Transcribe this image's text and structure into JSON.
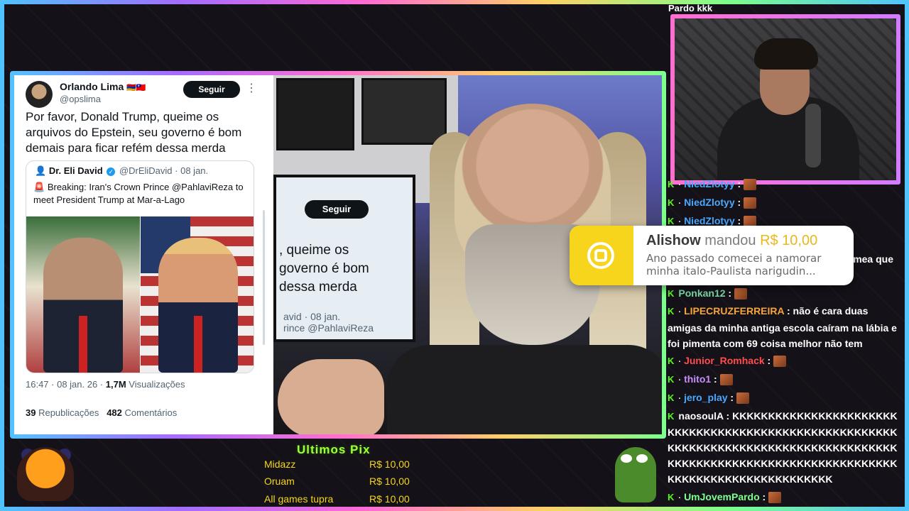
{
  "tweet": {
    "author_name": "Orlando Lima",
    "author_flags": "🇦🇲🇹🇼",
    "author_handle": "@opslima",
    "follow_label": "Seguir",
    "more_icon": "more-horizontal-icon",
    "text": "Por favor, Donald Trump, queime os arquivos do Epstein, seu governo é bom demais para ficar refém dessa merda",
    "quote": {
      "author_name": "Dr. Eli David",
      "author_handle": "@DrEliDavid",
      "date": "· 08 jan.",
      "siren": "🚨",
      "text": "Breaking: Iran's Crown Prince @PahlaviReza to meet President Trump at Mar-a-Lago"
    },
    "timestamp": "16:47 · 08 jan. 26 · ",
    "views_count": "1,7M",
    "views_label": " Visualizações",
    "reposts_count": "39",
    "reposts_label": " Republicações",
    "comments_count": "482",
    "comments_label": " Comentários"
  },
  "camera_monitor": {
    "follow_label": "Seguir",
    "text_line1": ", queime os",
    "text_line2": "governo é bom",
    "text_line3": "dessa merda",
    "sub_line1": "avid · 08 jan.",
    "sub_line2": "rince @PahlaviReza"
  },
  "alert": {
    "username": "Alishow",
    "verb": " mandou ",
    "amount": "R$ 10,00",
    "message": "Ano passado comecei a namorar minha italo-Paulista narigudin..."
  },
  "top_text": "Pardo kkk",
  "chat": [
    {
      "user": "NiedZlotyy",
      "text": " :",
      "color": "#4aa8ff",
      "emote": true
    },
    {
      "user": "NiedZlotyy",
      "text": " :",
      "color": "#4aa8ff",
      "emote": true
    },
    {
      "user": "NiedZlotyy",
      "text": " :",
      "color": "#4aa8ff",
      "emote": true
    },
    {
      "user": "",
      "text": "mea que",
      "color": "#ffffff",
      "emote": false
    },
    {
      "user": "Ponkan12",
      "text": " :",
      "color": "#7ad9a4",
      "emote": true
    },
    {
      "user": "LIPECRUZFERREIRA",
      "text": " : não é cara duas amigas da minha antiga escola caíram na lábia e foi pimenta com 69 coisa melhor não tem",
      "color": "#f7a43b",
      "emote": false
    },
    {
      "user": "Junior_Romhack",
      "text": " :",
      "color": "#ff4d4d",
      "emote": true
    },
    {
      "user": "thito1",
      "text": " :",
      "color": "#c98dff",
      "emote": true
    },
    {
      "user": "jero_play",
      "text": " :",
      "color": "#4aa8ff",
      "emote": true
    },
    {
      "user": "naosoulA",
      "text": " : KKKKKKKKKKKKKKKKKKKKKKKKKKKKKKKKKKKKKKKKKKKKKKKKKKKKKKKKKKKKKKKKKKKKKKKKKKKKKKKKKKKKKKKKKKKKKKKKKKKKKKKKKKKKKKKKKKKKKKKKKKKKKKKKKKKKKKKKKKKKKK",
      "color": "#ffffff",
      "emote": false
    },
    {
      "user": "UmJovemPardo",
      "text": " :",
      "color": "#7dff8e",
      "emote": true
    }
  ],
  "chat_badge": "K",
  "pix": {
    "title": "Ultimos Pix",
    "rows": [
      {
        "name": "Midazz",
        "amount": "R$ 10,00"
      },
      {
        "name": "Oruam",
        "amount": "R$ 10,00"
      },
      {
        "name": "All games tupra",
        "amount": "R$ 10,00"
      }
    ]
  }
}
